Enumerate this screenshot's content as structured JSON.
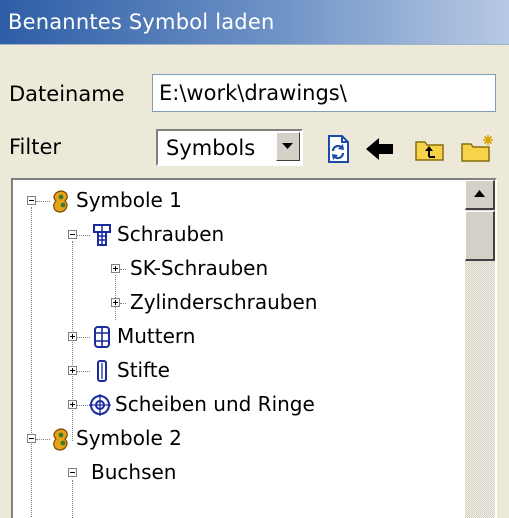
{
  "window": {
    "title": "Benanntes Symbol laden"
  },
  "form": {
    "filename_label": "Dateiname",
    "filename_value": "E:\\work\\drawings\\",
    "filter_label": "Filter",
    "filter_value": "Symbols"
  },
  "toolbar": {
    "icons": [
      "refresh-icon",
      "back-arrow-icon",
      "folder-up-icon",
      "new-folder-icon"
    ]
  },
  "tree": {
    "items": [
      {
        "label": "Symbole 1",
        "expanded": true,
        "icon": "symbol-group-icon"
      },
      {
        "label": "Schrauben",
        "expanded": true,
        "icon": "screw-icon"
      },
      {
        "label": "SK-Schrauben",
        "expanded": false
      },
      {
        "label": "Zylinderschrauben",
        "expanded": false
      },
      {
        "label": "Muttern",
        "expanded": false,
        "icon": "nut-icon"
      },
      {
        "label": "Stifte",
        "expanded": false,
        "icon": "pin-icon"
      },
      {
        "label": "Scheiben und Ringe",
        "expanded": false,
        "icon": "washer-icon"
      },
      {
        "label": "Symbole 2",
        "expanded": true,
        "icon": "symbol-group-icon"
      },
      {
        "label": "Buchsen",
        "expanded": true
      }
    ]
  },
  "colors": {
    "titlebar_start": "#2e5ea6",
    "titlebar_end": "#b7c9e4",
    "dialog_bg": "#ece9d8"
  }
}
